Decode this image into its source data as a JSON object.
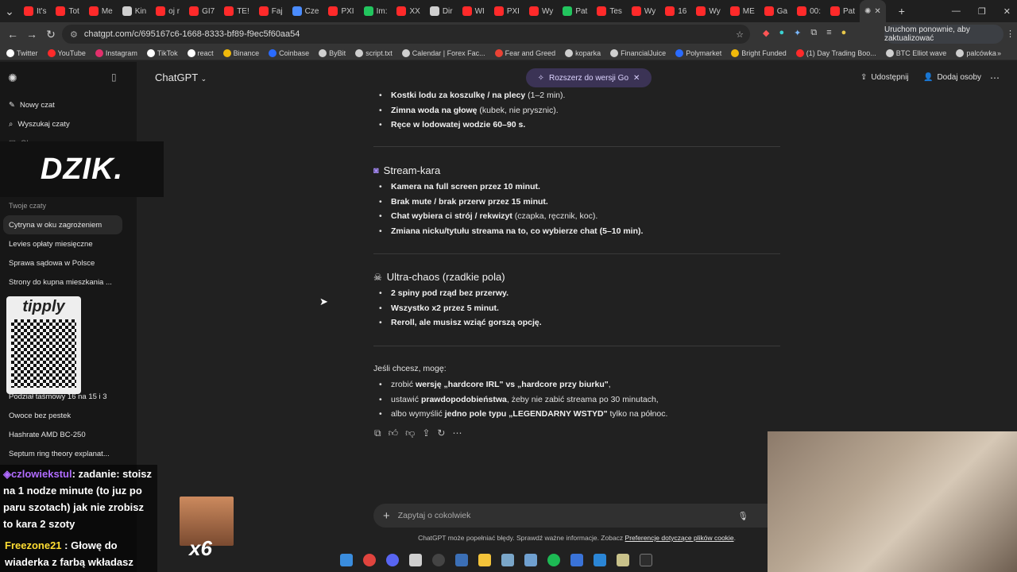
{
  "browser": {
    "tabs": [
      {
        "label": "It's",
        "color": "#ff2a2a"
      },
      {
        "label": "Tot",
        "color": "#ff2a2a"
      },
      {
        "label": "Me",
        "color": "#ff2a2a"
      },
      {
        "label": "Kin",
        "color": "#cfcfcf"
      },
      {
        "label": "oj r",
        "color": "#ff2a2a"
      },
      {
        "label": "GI7",
        "color": "#ff2a2a"
      },
      {
        "label": "TE!",
        "color": "#ff2a2a"
      },
      {
        "label": "Faj",
        "color": "#ff2a2a"
      },
      {
        "label": "Cze",
        "color": "#4a8cff"
      },
      {
        "label": "PXI",
        "color": "#ff2a2a"
      },
      {
        "label": "Im:",
        "color": "#22c55e"
      },
      {
        "label": "XX",
        "color": "#ff2a2a"
      },
      {
        "label": "Dir",
        "color": "#cfcfcf"
      },
      {
        "label": "WI",
        "color": "#ff2a2a"
      },
      {
        "label": "PXI",
        "color": "#ff2a2a"
      },
      {
        "label": "Wy",
        "color": "#ff2a2a"
      },
      {
        "label": "Pat",
        "color": "#22c55e"
      },
      {
        "label": "Tes",
        "color": "#ff2a2a"
      },
      {
        "label": "Wy",
        "color": "#ff2a2a"
      },
      {
        "label": "16",
        "color": "#ff2a2a"
      },
      {
        "label": "Wy",
        "color": "#ff2a2a"
      },
      {
        "label": "ME",
        "color": "#ff2a2a"
      },
      {
        "label": "Ga",
        "color": "#ff2a2a"
      },
      {
        "label": "00:",
        "color": "#ff2a2a"
      },
      {
        "label": "Pat",
        "color": "#ff2a2a"
      }
    ],
    "url": "chatgpt.com/c/695167c6-1668-8333-bf89-f9ec5f60aa54",
    "update_button": "Uruchom ponownie, aby zaktualizować",
    "bookmarks": [
      {
        "label": "Twitter",
        "color": "#ffffff"
      },
      {
        "label": "YouTube",
        "color": "#ff2a2a"
      },
      {
        "label": "Instagram",
        "color": "#e1306c"
      },
      {
        "label": "TikTok",
        "color": "#ffffff"
      },
      {
        "label": "react",
        "color": "#ffffff"
      },
      {
        "label": "Binance",
        "color": "#f0b90b"
      },
      {
        "label": "Coinbase",
        "color": "#2a6bff"
      },
      {
        "label": "ByBit",
        "color": "#cfcfcf"
      },
      {
        "label": "script.txt",
        "color": "#cfcfcf"
      },
      {
        "label": "Calendar | Forex Fac...",
        "color": "#cfcfcf"
      },
      {
        "label": "Fear and Greed",
        "color": "#ea4335"
      },
      {
        "label": "koparka",
        "color": "#cfcfcf"
      },
      {
        "label": "FinancialJuice",
        "color": "#cfcfcf"
      },
      {
        "label": "Polymarket",
        "color": "#2a6bff"
      },
      {
        "label": "Bright Funded",
        "color": "#f0b90b"
      },
      {
        "label": "(1) Day Trading Boo...",
        "color": "#ff2a2a"
      },
      {
        "label": "BTC Elliot wave",
        "color": "#cfcfcf"
      },
      {
        "label": "palcówka",
        "color": "#cfcfcf"
      }
    ]
  },
  "sidebar": {
    "new_chat": "Nowy czat",
    "search": "Wyszukaj czaty",
    "images": "Obrazy",
    "section_label": "Twoje czaty",
    "chats": [
      "Cytryna w oku zagrożeniem",
      "Levies opłaty miesięczne",
      "Sprawa sądowa w Polsce",
      "Strony do kupna mieszkania ...",
      "Podział taśmowy 16 na 15 i 3",
      "Owoce bez pestek",
      "Hashrate AMD BC-250",
      "Septum ring theory explanat..."
    ]
  },
  "header": {
    "model": "ChatGPT",
    "upgrade": "Rozszerz do wersji Go",
    "share": "Udostępnij",
    "add_people": "Dodaj osoby"
  },
  "message": {
    "top_bullets": [
      {
        "bold": "Kostki lodu za koszulkę / na plecy",
        "rest": " (1–2 min)."
      },
      {
        "bold": "Zimna woda na głowę",
        "rest": " (kubek, nie prysznic)."
      },
      {
        "bold": "Ręce w lodowatej wodzie 60–90 s.",
        "rest": ""
      }
    ],
    "stream_title": "Stream-kara",
    "stream_bullets": [
      {
        "bold": "Kamera na full screen przez 10 minut.",
        "rest": ""
      },
      {
        "bold": "Brak mute / brak przerw przez 15 minut.",
        "rest": ""
      },
      {
        "bold": "Chat wybiera ci strój / rekwizyt",
        "rest": " (czapka, ręcznik, koc)."
      },
      {
        "bold": "Zmiana nicku/tytułu streama na to, co wybierze chat (5–10 min).",
        "rest": ""
      }
    ],
    "chaos_title": "Ultra-chaos (rzadkie pola)",
    "chaos_bullets": [
      {
        "bold": "2 spiny pod rząd bez przerwy.",
        "rest": ""
      },
      {
        "bold": "Wszystko x2 przez 5 minut.",
        "rest": ""
      },
      {
        "bold": "Reroll, ale musisz wziąć gorszą opcję.",
        "rest": ""
      }
    ],
    "closing_intro": "Jeśli chcesz, mogę:",
    "closing_bullets": [
      {
        "pre": "zrobić ",
        "bold": "wersję „hardcore IRL\" vs „hardcore przy biurku\"",
        "rest": ","
      },
      {
        "pre": "ustawić ",
        "bold": "prawdopodobieństwa",
        "rest": ", żeby nie zabić streama po 30 minutach,"
      },
      {
        "pre": "albo wymyślić ",
        "bold": "jedno pole typu „LEGENDARNY WSTYD\"",
        "rest": " tylko na północ."
      }
    ]
  },
  "composer": {
    "placeholder": "Zapytaj o cokolwiek",
    "disclaimer_text": "ChatGPT może popełniać błędy. Sprawdź ważne informacje. Zobacz ",
    "disclaimer_link": "Preferencje dotyczące plików cookie",
    "disclaimer_end": "."
  },
  "overlay": {
    "brand": "DZIK.",
    "tipply": "tipply",
    "chat1_user": "czlowiekstul",
    "chat1_text": ": zadanie: stoisz na 1 nodze minute (to juz po paru szotach) jak nie zrobisz to kara 2 szoty",
    "chat2_user": "Freezone21",
    "chat2_text": " : Głowę do wiaderka z farbą wkładasz",
    "multiplier": "x6"
  }
}
